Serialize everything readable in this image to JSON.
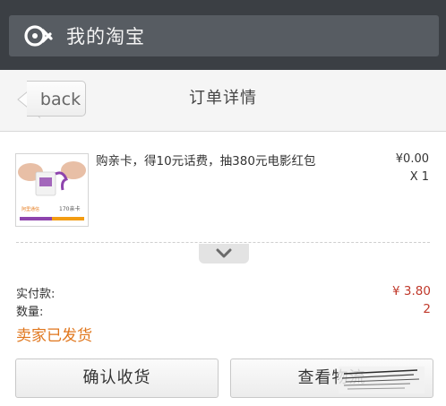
{
  "header": {
    "title": "我的淘宝",
    "logo_icon": "taobao-eye-icon"
  },
  "nav": {
    "back_label": "back",
    "page_title": "订单详情"
  },
  "item": {
    "title": "购亲卡，得10元话费，抽380元电影红包",
    "price": "¥0.00",
    "quantity": "X 1",
    "thumb_card_label": "170亲卡",
    "thumb_brand": "阿里通信"
  },
  "summary": {
    "paid_label": "实付款:",
    "paid_value": "¥ 3.80",
    "count_label": "数量:",
    "count_value": "2"
  },
  "status": "卖家已发货",
  "buttons": {
    "confirm_label": "确认收货",
    "view_label": "查看物流"
  },
  "colors": {
    "topbar": "#3b3f44",
    "price_red": "#c0392b",
    "status_orange": "#e0761c",
    "thumb_accent_purple": "#8e44ad",
    "thumb_accent_orange": "#f39c12"
  }
}
